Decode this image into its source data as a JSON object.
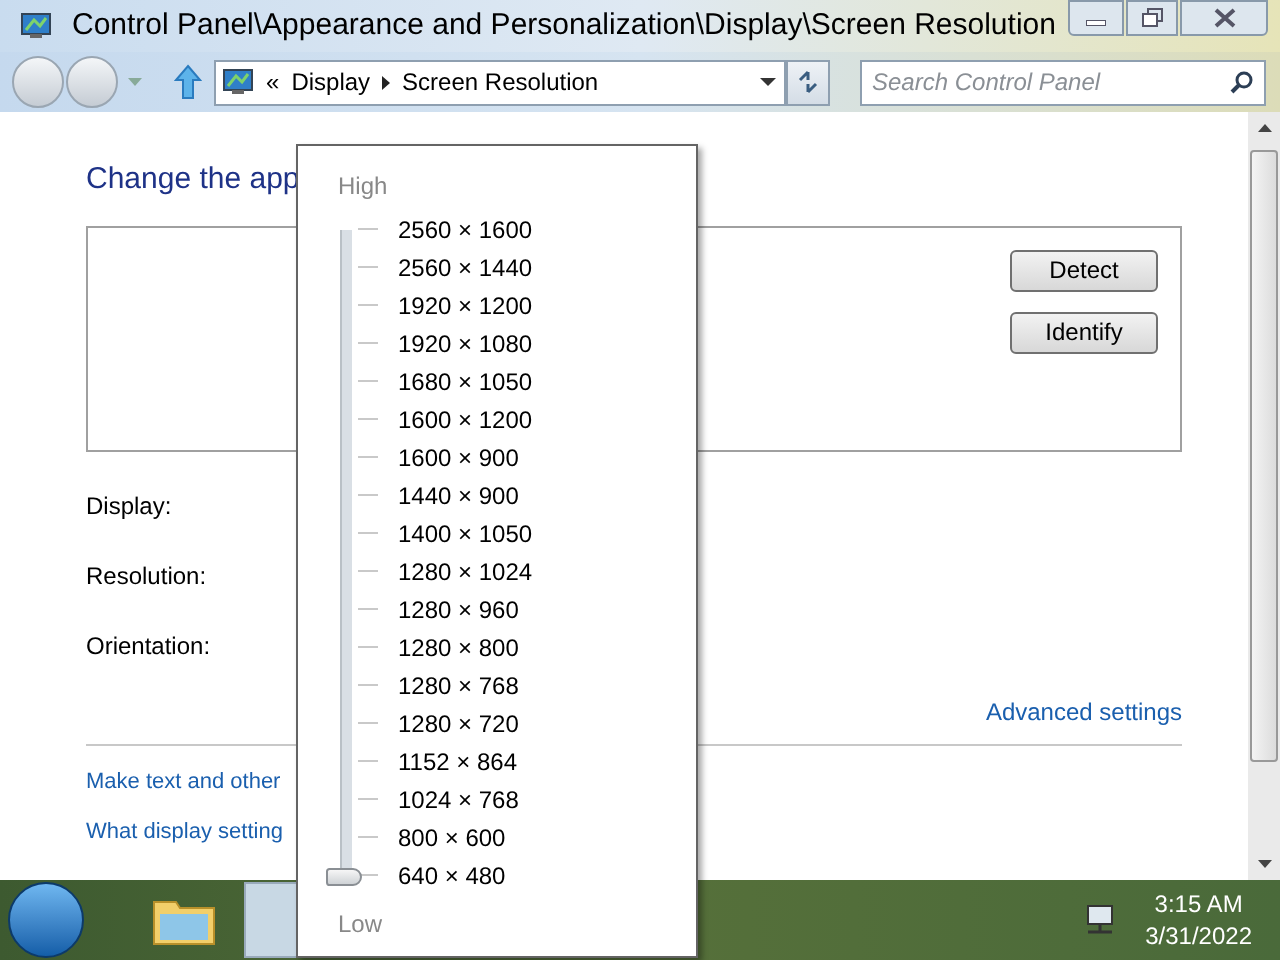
{
  "window": {
    "title": "Control Panel\\Appearance and Personalization\\Display\\Screen Resolution"
  },
  "address_bar": {
    "overflow": "«",
    "breadcrumbs": [
      "Display",
      "Screen Resolution"
    ]
  },
  "search": {
    "placeholder": "Search Control Panel"
  },
  "content": {
    "heading": "Change the app",
    "buttons": [
      "Detect",
      "Identify"
    ],
    "labels": [
      "Display:",
      "Resolution:",
      "Orientation:"
    ],
    "advanced_link": "Advanced settings",
    "links": [
      "Make text and other",
      "What display setting"
    ]
  },
  "resolution_popup": {
    "high_label": "High",
    "low_label": "Low",
    "level": 0,
    "options": [
      "2560 × 1600",
      "2560 × 1440",
      "1920 × 1200",
      "1920 × 1080",
      "1680 × 1050",
      "1600 × 1200",
      "1600 × 900",
      "1440 × 900",
      "1400 × 1050",
      "1280 × 1024",
      "1280 × 960",
      "1280 × 800",
      "1280 × 768",
      "1280 × 720",
      "1152 × 864",
      "1024 × 768",
      "800 × 600",
      "640 × 480"
    ]
  },
  "taskbar": {
    "time": "3:15 AM",
    "date": "3/31/2022"
  }
}
